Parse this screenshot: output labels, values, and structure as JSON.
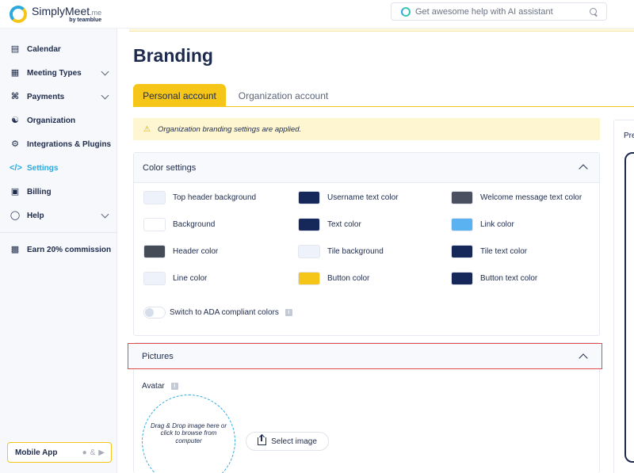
{
  "header": {
    "logo_main": "SimplyMeet",
    "logo_suffix": ".me",
    "logo_by": "by teamblue",
    "ai_placeholder": "Get awesome help with AI assistant"
  },
  "sidebar": {
    "items": [
      {
        "label": "Calendar",
        "icon": "calendar-icon"
      },
      {
        "label": "Meeting Types",
        "icon": "grid-icon"
      },
      {
        "label": "Payments",
        "icon": "paperclip-icon"
      },
      {
        "label": "Organization",
        "icon": "org-chart-icon"
      },
      {
        "label": "Integrations & Plugins",
        "icon": "plug-icon"
      },
      {
        "label": "Settings",
        "icon": "code-icon"
      },
      {
        "label": "Billing",
        "icon": "banknote-icon"
      },
      {
        "label": "Help",
        "icon": "chat-bubble-icon"
      }
    ],
    "commission": "Earn 20% commission",
    "mobile_app": "Mobile App",
    "mobile_sep": "&"
  },
  "page": {
    "title": "Branding",
    "tabs": [
      "Personal account",
      "Organization account"
    ],
    "alert": "Organization branding settings are applied."
  },
  "colors": {
    "title": "Color settings",
    "items": [
      {
        "label": "Top header background",
        "color": "#eef2fb"
      },
      {
        "label": "Username text color",
        "color": "#16285a"
      },
      {
        "label": "Welcome message text color",
        "color": "#4a5060"
      },
      {
        "label": "Background",
        "color": "#ffffff"
      },
      {
        "label": "Text color",
        "color": "#16285a"
      },
      {
        "label": "Link color",
        "color": "#5ab3f0"
      },
      {
        "label": "Header color",
        "color": "#454b57"
      },
      {
        "label": "Tile background",
        "color": "#eef2fb"
      },
      {
        "label": "Tile text color",
        "color": "#16285a"
      },
      {
        "label": "Line color",
        "color": "#eef2fb"
      },
      {
        "label": "Button color",
        "color": "#f5c518"
      },
      {
        "label": "Button text color",
        "color": "#16285a"
      }
    ],
    "ada_label": "Switch to ADA compliant colors"
  },
  "pictures": {
    "title": "Pictures",
    "avatar_label": "Avatar",
    "dropzone_text": "Drag & Drop image here or click to browse from computer",
    "select_label": "Select image"
  },
  "preview": {
    "label": "Pre"
  },
  "theme": {
    "accent": "#f5c518",
    "link": "#2aa9e0",
    "navy": "#1d2a4b"
  }
}
